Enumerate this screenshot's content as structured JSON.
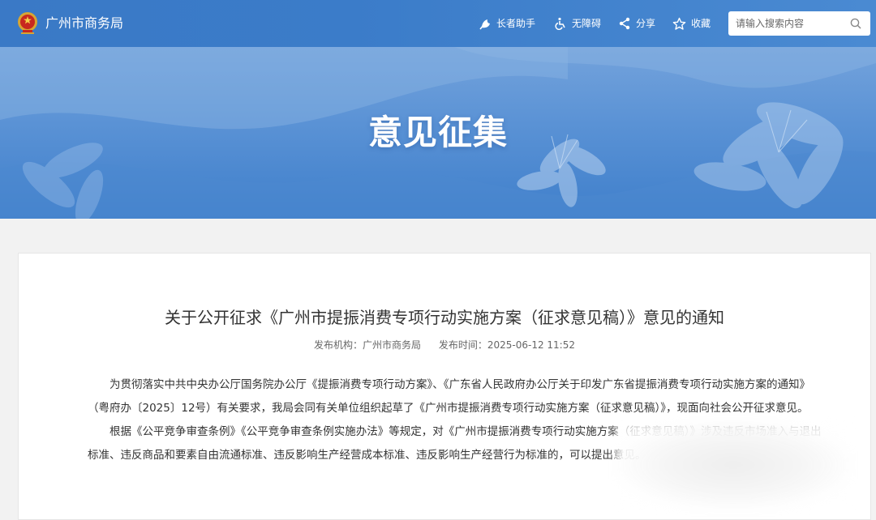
{
  "header": {
    "site_name": "广州市商务局",
    "tools": {
      "elder": "长者助手",
      "accessible": "无障碍",
      "share": "分享",
      "favorite": "收藏"
    },
    "search": {
      "placeholder": "请输入搜索内容",
      "value": ""
    }
  },
  "hero": {
    "title": "意见征集"
  },
  "article": {
    "title": "关于公开征求《广州市提振消费专项行动实施方案（征求意见稿）》意见的通知",
    "publisher_label": "发布机构：",
    "publisher": "广州市商务局",
    "date_label": "发布时间：",
    "date": "2025-06-12 11:52",
    "paragraphs": [
      "为贯彻落实中共中央办公厅国务院办公厅《提振消费专项行动方案》、《广东省人民政府办公厅关于印发广东省提振消费专项行动实施方案的通知》（粤府办〔2025〕12号）有关要求，我局会同有关单位组织起草了《广州市提振消费专项行动实施方案（征求意见稿）》，现面向社会公开征求意见。",
      "根据《公平竞争审查条例》《公平竞争审查条例实施办法》等规定，对《广州市提振消费专项行动实施方案（征求意见稿）》涉及违反市场准入与退出标准、违反商品和要素自由流通标准、违反影响生产经营成本标准、违反影响生产经营行为标准的，可以提出意见。"
    ]
  },
  "colors": {
    "nav_bg": "#3b7cc9",
    "hero_bg": "#5a92d5",
    "card_bg": "#ffffff",
    "page_bg": "#f2f2f2"
  }
}
